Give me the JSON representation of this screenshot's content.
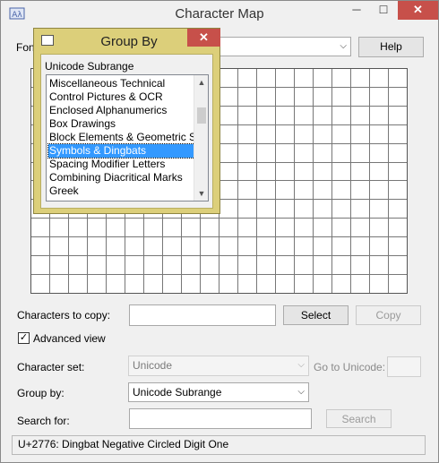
{
  "window": {
    "title": "Character Map",
    "minimize": "─",
    "maximize": "☐",
    "close": "✕",
    "font_label": "Font :",
    "help_button": "Help"
  },
  "controls": {
    "chars_to_copy_label": "Characters to copy:",
    "chars_to_copy_value": "",
    "select_button": "Select",
    "copy_button": "Copy",
    "advanced_view_label": "Advanced view",
    "advanced_view_checked": "✓",
    "character_set_label": "Character set:",
    "character_set_value": "Unicode",
    "go_to_unicode_label": "Go to Unicode:",
    "group_by_label": "Group by:",
    "group_by_value": "Unicode Subrange",
    "search_for_label": "Search for:",
    "search_value": "",
    "search_button": "Search"
  },
  "status": {
    "text": "U+2776: Dingbat Negative Circled Digit One"
  },
  "dialog": {
    "title": "Group By",
    "close": "✕",
    "list_label": "Unicode Subrange",
    "items": [
      "Miscellaneous Technical",
      "Control Pictures & OCR",
      "Enclosed Alphanumerics",
      "Box Drawings",
      "Block Elements & Geometric Shapes",
      "Symbols & Dingbats",
      "Spacing Modifier Letters",
      "Combining Diacritical Marks",
      "Greek"
    ],
    "selected_item": "Symbols & Dingbats"
  },
  "colors": {
    "dialog_frame": "#dccf7a",
    "selection": "#3399ff",
    "close_button": "#c7504a"
  }
}
